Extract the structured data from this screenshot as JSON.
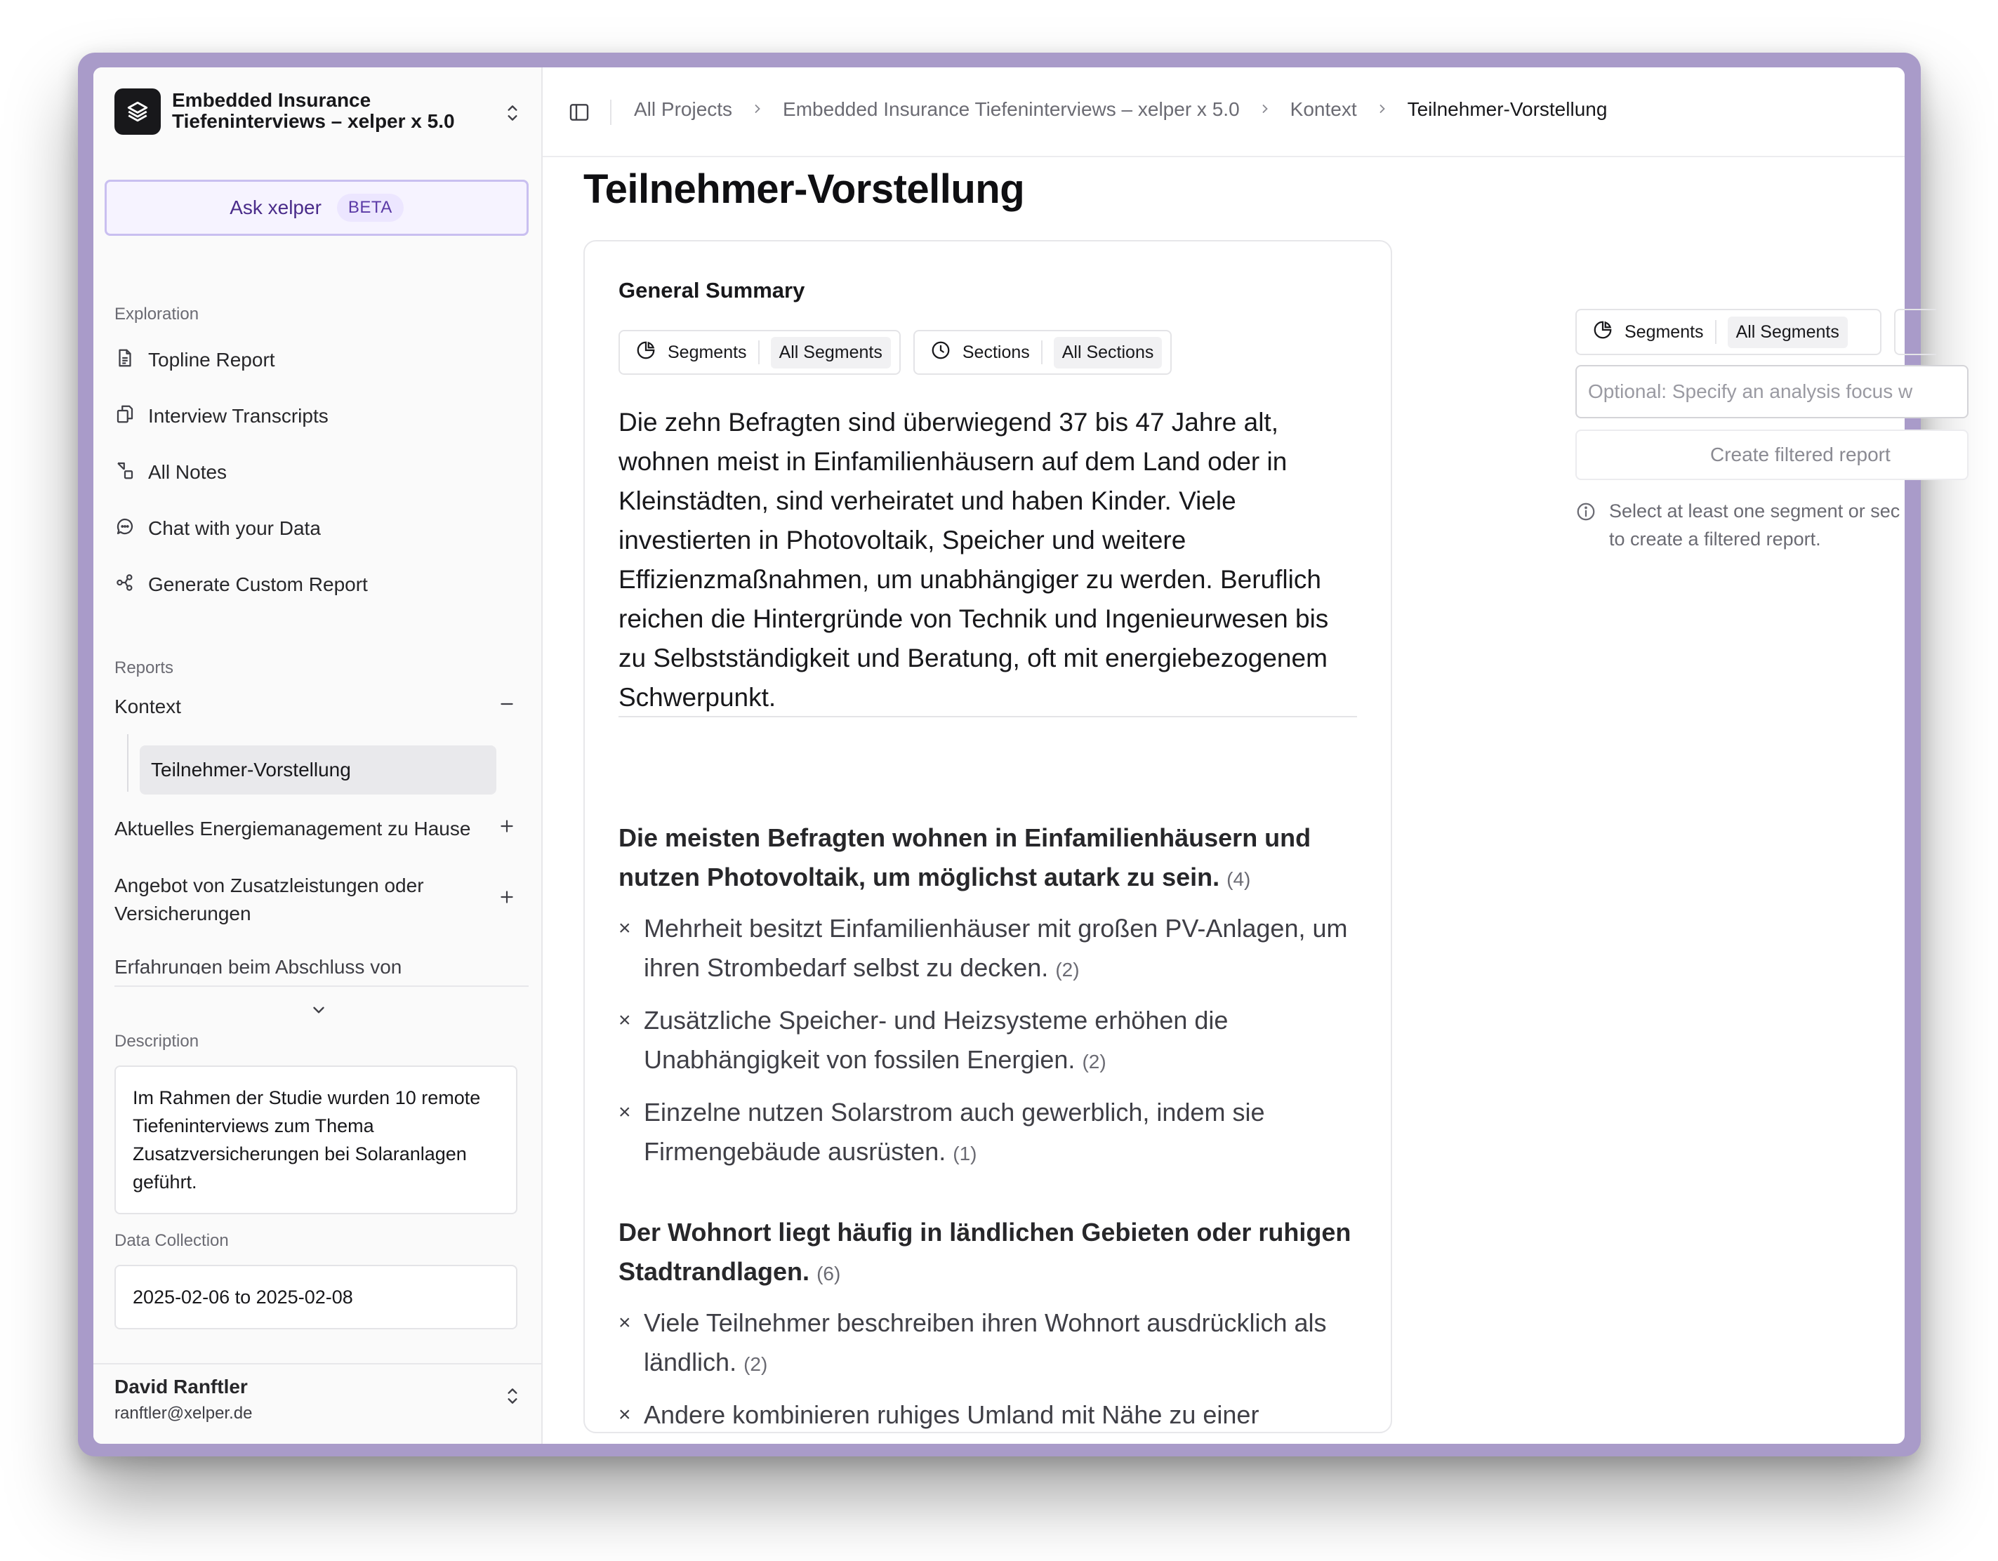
{
  "sidebar": {
    "project_name": "Embedded Insurance Tiefeninterviews – xelper x 5.0",
    "ask_label": "Ask xelper",
    "ask_badge": "BETA",
    "exploration_label": "Exploration",
    "exploration_items": [
      {
        "label": "Topline Report",
        "icon": "document-icon"
      },
      {
        "label": "Interview Transcripts",
        "icon": "copy-icon"
      },
      {
        "label": "All Notes",
        "icon": "notes-icon"
      },
      {
        "label": "Chat with your Data",
        "icon": "chat-icon"
      },
      {
        "label": "Generate Custom Report",
        "icon": "workflow-icon"
      }
    ],
    "reports_label": "Reports",
    "reports": [
      {
        "label": "Kontext",
        "expanded": true,
        "children": [
          "Teilnehmer-Vorstellung"
        ]
      },
      {
        "label": "Aktuelles Energiemanagement zu Hause",
        "expanded": false
      },
      {
        "label": "Angebot von Zusatzleistungen oder Versicherungen",
        "expanded": false
      },
      {
        "label": "Erfahrungen beim Abschluss von",
        "expanded": false
      }
    ],
    "description_label": "Description",
    "description_text": "Im Rahmen der Studie wurden 10 remote Tiefeninterviews zum Thema Zusatzversicherungen bei Solaranlagen geführt.",
    "data_collection_label": "Data Collection",
    "data_collection_value": "2025-02-06 to 2025-02-08",
    "user": {
      "name": "David Ranftler",
      "email": "ranftler@xelper.de"
    }
  },
  "breadcrumb": [
    "All Projects",
    "Embedded Insurance Tiefeninterviews – xelper x 5.0",
    "Kontext",
    "Teilnehmer-Vorstellung"
  ],
  "main": {
    "title": "Teilnehmer-Vorstellung",
    "card_title": "General Summary",
    "filters": [
      {
        "label": "Segments",
        "value": "All Segments",
        "icon": "pie-icon"
      },
      {
        "label": "Sections",
        "value": "All Sections",
        "icon": "clock-icon"
      }
    ],
    "summary": "Die zehn Befragten sind überwiegend 37 bis 47 Jahre alt, wohnen meist in Einfamilienhäusern auf dem Land oder in Kleinstädten, sind verheiratet und haben Kinder. Viele investierten in Photovoltaik, Speicher und weitere Effizienzmaßnahmen, um unabhängiger zu werden. Beruflich reichen die Hintergründe von Technik und Ingenieurwesen bis zu Selbstständigkeit und Beratung, oft mit energiebezogenem Schwerpunkt.",
    "themes": [
      {
        "heading": "Die meisten Befragten wohnen in Einfamilienhäusern und nutzen Photovoltaik, um möglichst autark zu sein.",
        "count": "(4)",
        "bullets": [
          {
            "text": "Mehrheit besitzt Einfamilienhäuser mit großen PV-Anlagen, um ihren Strombedarf selbst zu decken.",
            "count": "(2)"
          },
          {
            "text": "Zusätzliche Speicher- und Heizsysteme erhöhen die Unabhängigkeit von fossilen Energien.",
            "count": "(2)"
          },
          {
            "text": "Einzelne nutzen Solarstrom auch gewerblich, indem sie Firmengebäude ausrüsten.",
            "count": "(1)"
          }
        ]
      },
      {
        "heading": "Der Wohnort liegt häufig in ländlichen Gebieten oder ruhigen Stadtrandlagen.",
        "count": "(6)",
        "bullets": [
          {
            "text": "Viele Teilnehmer beschreiben ihren Wohnort ausdrücklich als ländlich.",
            "count": "(2)"
          },
          {
            "text": "Andere kombinieren ruhiges Umland mit Nähe zu einer",
            "count": ""
          }
        ]
      }
    ]
  },
  "right_panel": {
    "segments_label": "Segments",
    "segments_value": "All Segments",
    "focus_placeholder": "Optional: Specify an analysis focus w",
    "create_label": "Create filtered report",
    "hint_line1": "Select at least one segment or sec",
    "hint_line2": "to create a filtered report."
  }
}
